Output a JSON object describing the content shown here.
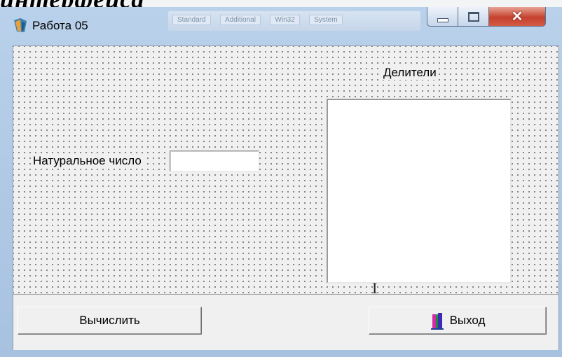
{
  "background_heading": "интерфейса",
  "background_palette_tabs": [
    "Standard",
    "Additional",
    "Win32",
    "System"
  ],
  "window": {
    "title": "Работа 05",
    "icons": {
      "app": "delphi-app-icon",
      "minimize": "minimize-icon",
      "maximize": "maximize-icon",
      "close": "close-icon"
    }
  },
  "form": {
    "number_label": "Натуральное число",
    "number_value": "",
    "divisors_label": "Делители",
    "divisors_items": []
  },
  "buttons": {
    "calculate_label": "Вычислить",
    "exit_label": "Выход",
    "exit_icon": "door-exit-icon"
  },
  "colors": {
    "close_button": "#c4412d",
    "title_bar": "#b9d1ea",
    "form_bg": "#f0f0f0"
  }
}
